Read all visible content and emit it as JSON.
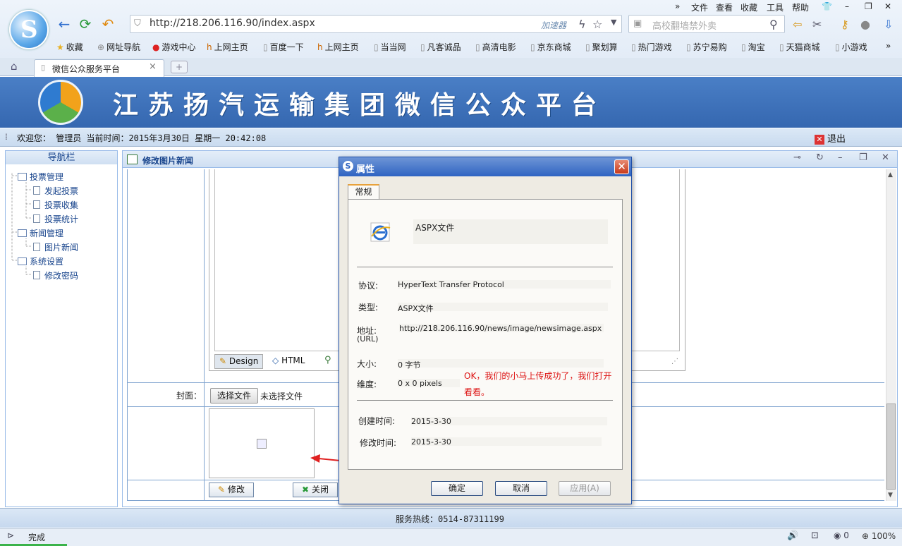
{
  "browser": {
    "menu": [
      "文件",
      "查看",
      "收藏",
      "工具",
      "帮助"
    ],
    "url": "http://218.206.116.90/index.aspx",
    "accelerator": "加速器",
    "search_placeholder": "高校翻墙禁外卖",
    "favorites": [
      "收藏",
      "网址导航",
      "游戏中心",
      "上网主页",
      "百度一下",
      "上网主页",
      "当当网",
      "凡客诚品",
      "高清电影",
      "京东商城",
      "聚划算",
      "热门游戏",
      "苏宁易购",
      "淘宝",
      "天猫商城",
      "小游戏"
    ],
    "tab_title": "微信公众服务平台",
    "status": "完成",
    "zoom": "100%",
    "status_count": "0"
  },
  "site": {
    "title": "江苏扬汽运输集团微信公众平台",
    "welcome": "欢迎您： 管理员 当前时间：2015年3月30日 星期一 20:42:08",
    "logout": "退出",
    "footer": "服务热线：0514-87311199"
  },
  "sidebar": {
    "header": "导航栏",
    "groups": [
      {
        "label": "投票管理",
        "items": [
          "发起投票",
          "投票收集",
          "投票统计"
        ]
      },
      {
        "label": "新闻管理",
        "items": [
          "图片新闻"
        ]
      },
      {
        "label": "系统设置",
        "items": [
          "修改密码"
        ]
      }
    ]
  },
  "panel": {
    "title": "修改图片新闻",
    "editor_tabs": [
      "Design",
      "HTML"
    ],
    "cover_label": "封面：",
    "choose_file": "选择文件",
    "no_file": "未选择文件",
    "modify": "修改",
    "close": "关闭"
  },
  "dialog": {
    "title": "属性",
    "tab": "常规",
    "file_name": "ASPX文件",
    "protocol_label": "协议:",
    "protocol": "HyperText Transfer Protocol",
    "type_label": "类型:",
    "type": "ASPX文件",
    "address_label": "地址:",
    "address_sub": "(URL)",
    "address": "http://218.206.116.90/news/image/newsimage.aspx",
    "size_label": "大小:",
    "size": "0 字节",
    "dimensions_label": "维度:",
    "dimensions": "0 x 0 pixels",
    "created_label": "创建时间:",
    "created": "2015-3-30",
    "modified_label": "修改时间:",
    "modified": "2015-3-30",
    "note": "OK，我们的小马上传成功了，我们打开看看。",
    "ok": "确定",
    "cancel": "取消",
    "apply": "应用(A)"
  }
}
